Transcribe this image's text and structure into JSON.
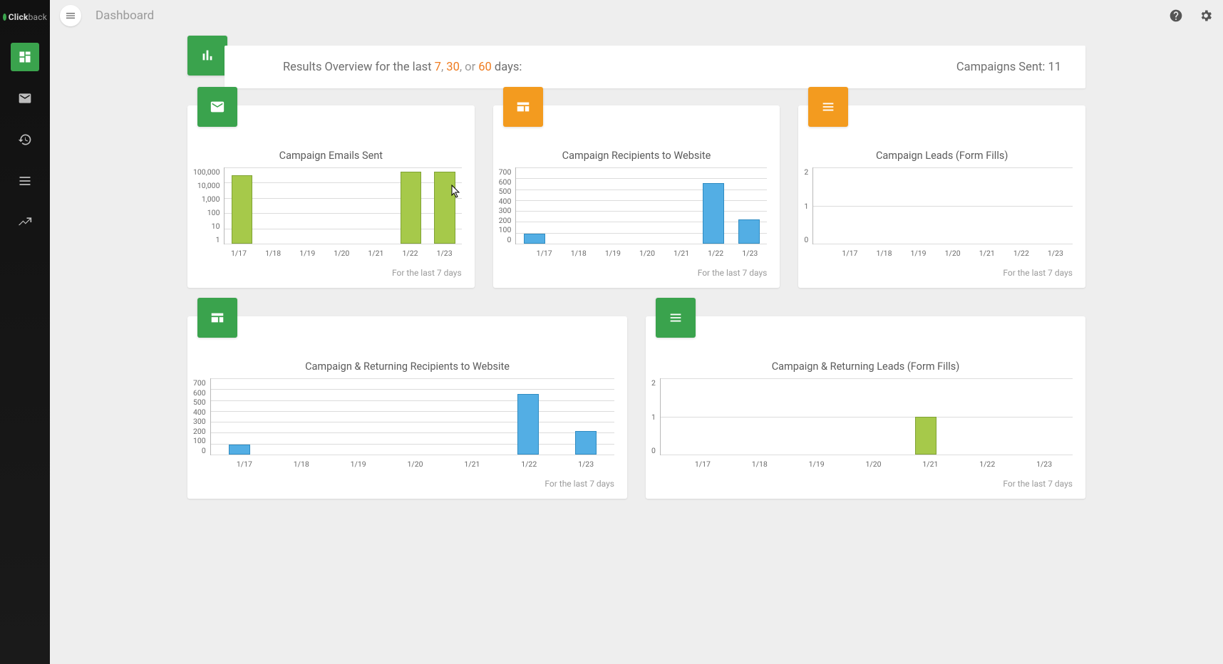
{
  "brand": {
    "pre": "Click",
    "suf": "back"
  },
  "sidebar": {
    "items": [
      {
        "name": "dashboard",
        "active": true
      },
      {
        "name": "email"
      },
      {
        "name": "history"
      },
      {
        "name": "lists"
      },
      {
        "name": "trends"
      }
    ]
  },
  "topbar": {
    "title": "Dashboard",
    "help_icon": "help-circle",
    "settings_icon": "gear"
  },
  "overview": {
    "text_prefix": "Results Overview for the last ",
    "days": [
      "7",
      "30",
      "60"
    ],
    "sep1": ", ",
    "sep2": ", or ",
    "text_suffix": " days:",
    "campaigns_label": "Campaigns Sent: ",
    "campaigns_count": "11"
  },
  "cards": [
    {
      "title": "Campaign Emails Sent",
      "footer": "For the last 7 days",
      "chip": "green",
      "chip_icon": "mail"
    },
    {
      "title": "Campaign Recipients to Website",
      "footer": "For the last 7 days",
      "chip": "orange",
      "chip_icon": "web"
    },
    {
      "title": "Campaign Leads (Form Fills)",
      "footer": "For the last 7 days",
      "chip": "orange",
      "chip_icon": "form"
    },
    {
      "title": "Campaign & Returning Recipients to Website",
      "footer": "For the last 7 days",
      "chip": "green",
      "chip_icon": "web"
    },
    {
      "title": "Campaign & Returning Leads (Form Fills)",
      "footer": "For the last 7 days",
      "chip": "green",
      "chip_icon": "form"
    }
  ],
  "chart_data": [
    {
      "id": "emails_sent",
      "type": "bar",
      "title": "Campaign Emails Sent",
      "categories": [
        "1/17",
        "1/18",
        "1/19",
        "1/20",
        "1/21",
        "1/22",
        "1/23"
      ],
      "values": [
        30000,
        0,
        0,
        0,
        0,
        50000,
        50000
      ],
      "yscale": "log",
      "yticks": [
        "100,000",
        "10,000",
        "1,000",
        "100",
        "10",
        "1"
      ],
      "color": "lime"
    },
    {
      "id": "recipients",
      "type": "bar",
      "title": "Campaign Recipients to Website",
      "categories": [
        "1/17",
        "1/18",
        "1/19",
        "1/20",
        "1/21",
        "1/22",
        "1/23"
      ],
      "values": [
        90,
        0,
        0,
        0,
        0,
        555,
        220
      ],
      "yscale": "linear",
      "ymax": 700,
      "yticks": [
        "700",
        "600",
        "500",
        "400",
        "300",
        "200",
        "100",
        "0"
      ],
      "color": "blue"
    },
    {
      "id": "leads",
      "type": "bar",
      "title": "Campaign Leads (Form Fills)",
      "categories": [
        "1/17",
        "1/18",
        "1/19",
        "1/20",
        "1/21",
        "1/22",
        "1/23"
      ],
      "values": [
        0,
        0,
        0,
        0,
        0,
        0,
        0
      ],
      "yscale": "linear",
      "ymax": 2,
      "yticks": [
        "2",
        "1",
        "0"
      ],
      "color": "blue"
    },
    {
      "id": "all_recipients",
      "type": "bar",
      "title": "Campaign & Returning Recipients to Website",
      "categories": [
        "1/17",
        "1/18",
        "1/19",
        "1/20",
        "1/21",
        "1/22",
        "1/23"
      ],
      "values": [
        90,
        0,
        0,
        0,
        0,
        555,
        215
      ],
      "yscale": "linear",
      "ymax": 700,
      "yticks": [
        "700",
        "600",
        "500",
        "400",
        "300",
        "200",
        "100",
        "0"
      ],
      "color": "blue"
    },
    {
      "id": "all_leads",
      "type": "bar",
      "title": "Campaign & Returning Leads (Form Fills)",
      "categories": [
        "1/17",
        "1/18",
        "1/19",
        "1/20",
        "1/21",
        "1/22",
        "1/23"
      ],
      "values": [
        0,
        0,
        0,
        0,
        1,
        0,
        0
      ],
      "yscale": "linear",
      "ymax": 2,
      "yticks": [
        "2",
        "1",
        "0"
      ],
      "color": "lime"
    }
  ]
}
